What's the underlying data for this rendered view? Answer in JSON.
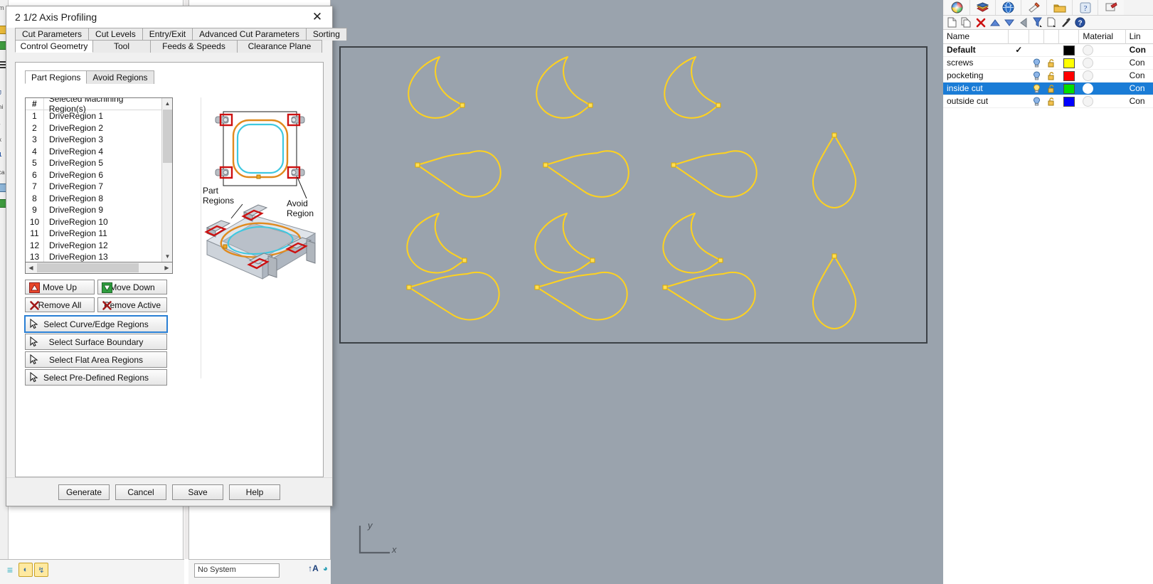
{
  "dialog": {
    "title": "2 1/2 Axis Profiling",
    "close_icon": "close-icon",
    "tabs_row1": [
      {
        "label": "Cut Parameters",
        "active": false
      },
      {
        "label": "Cut Levels",
        "active": false
      },
      {
        "label": "Entry/Exit",
        "active": false
      },
      {
        "label": "Advanced Cut Parameters",
        "active": false
      },
      {
        "label": "Sorting",
        "active": false
      }
    ],
    "tabs_row2": [
      {
        "label": "Control Geometry",
        "active": true
      },
      {
        "label": "Tool",
        "active": false
      },
      {
        "label": "Feeds & Speeds",
        "active": false
      },
      {
        "label": "Clearance Plane",
        "active": false
      }
    ],
    "inner_tabs": [
      {
        "label": "Part Regions",
        "active": true
      },
      {
        "label": "Avoid Regions",
        "active": false
      }
    ],
    "list": {
      "headers": {
        "num": "#",
        "name": "Selected Machining Region(s)"
      },
      "rows": [
        {
          "num": "1",
          "name": "DriveRegion 1"
        },
        {
          "num": "2",
          "name": "DriveRegion 2"
        },
        {
          "num": "3",
          "name": "DriveRegion 3"
        },
        {
          "num": "4",
          "name": "DriveRegion 4"
        },
        {
          "num": "5",
          "name": "DriveRegion 5"
        },
        {
          "num": "6",
          "name": "DriveRegion 6"
        },
        {
          "num": "7",
          "name": "DriveRegion 7"
        },
        {
          "num": "8",
          "name": "DriveRegion 8"
        },
        {
          "num": "9",
          "name": "DriveRegion 9"
        },
        {
          "num": "10",
          "name": "DriveRegion 10"
        },
        {
          "num": "11",
          "name": "DriveRegion 11"
        },
        {
          "num": "12",
          "name": "DriveRegion 12"
        },
        {
          "num": "13",
          "name": "DriveRegion 13"
        }
      ]
    },
    "buttons": {
      "move_up": "Move Up",
      "move_down": "Move Down",
      "remove_all": "Remove All",
      "remove_active": "Remove Active",
      "select_curve_edge": "Select Curve/Edge Regions",
      "select_surface_boundary": "Select Surface Boundary",
      "select_flat_area": "Select Flat Area Regions",
      "select_predefined": "Select Pre-Defined Regions"
    },
    "illustration": {
      "label_part_regions": "Part\nRegions",
      "label_avoid_region": "Avoid\nRegion",
      "part_color": "#e08a1e",
      "avoid_color": "#3ec8e0",
      "clamp_color": "#cc1111"
    },
    "footer": {
      "generate": "Generate",
      "cancel": "Cancel",
      "save": "Save",
      "help": "Help"
    }
  },
  "viewport": {
    "background": "#9aa3ad",
    "curve_color": "#ffd21e",
    "border_color": "#3c4146",
    "axis": {
      "x": "x",
      "y": "y"
    }
  },
  "layers_panel": {
    "tab_icons": [
      "color-wheel-icon",
      "render-materials-icon",
      "environments-icon",
      "ground-plane-icon",
      "layers-folder-icon",
      "help-panel-icon",
      "display-icon"
    ],
    "toolbar_icons": [
      "new-layer-icon",
      "copy-layer-icon",
      "delete-layer-icon",
      "move-up-icon",
      "move-down-icon",
      "back-arrow-icon",
      "filter-icon",
      "new-sublayer-icon",
      "layer-tools-icon",
      "help-icon"
    ],
    "columns": [
      "Name",
      "",
      "",
      "",
      "",
      "Material",
      "Lin"
    ],
    "rows": [
      {
        "name": "Default",
        "current": true,
        "visible": false,
        "lock": false,
        "color": "#000000",
        "material": false,
        "linetype": "Con",
        "selected": false,
        "bold": true
      },
      {
        "name": "screws",
        "current": false,
        "visible": true,
        "lock": true,
        "color": "#ffff00",
        "material": false,
        "linetype": "Con",
        "selected": false,
        "bold": false
      },
      {
        "name": "pocketing",
        "current": false,
        "visible": true,
        "lock": true,
        "color": "#ff0000",
        "material": false,
        "linetype": "Con",
        "selected": false,
        "bold": false
      },
      {
        "name": "inside cut",
        "current": false,
        "visible": true,
        "lock": true,
        "color": "#00e000",
        "material": true,
        "linetype": "Con",
        "selected": true,
        "bold": false
      },
      {
        "name": "outside cut",
        "current": false,
        "visible": true,
        "lock": true,
        "color": "#0000ff",
        "material": false,
        "linetype": "Con",
        "selected": false,
        "bold": false
      }
    ],
    "selection_color": "#1a7cd6"
  },
  "status_bar": {
    "icons": [
      "grid-snap-icon",
      "osnap-icon",
      "smart-track-icon"
    ],
    "combo_value": "No System",
    "right_icons": [
      "text-size-icon",
      "render-icon"
    ]
  }
}
